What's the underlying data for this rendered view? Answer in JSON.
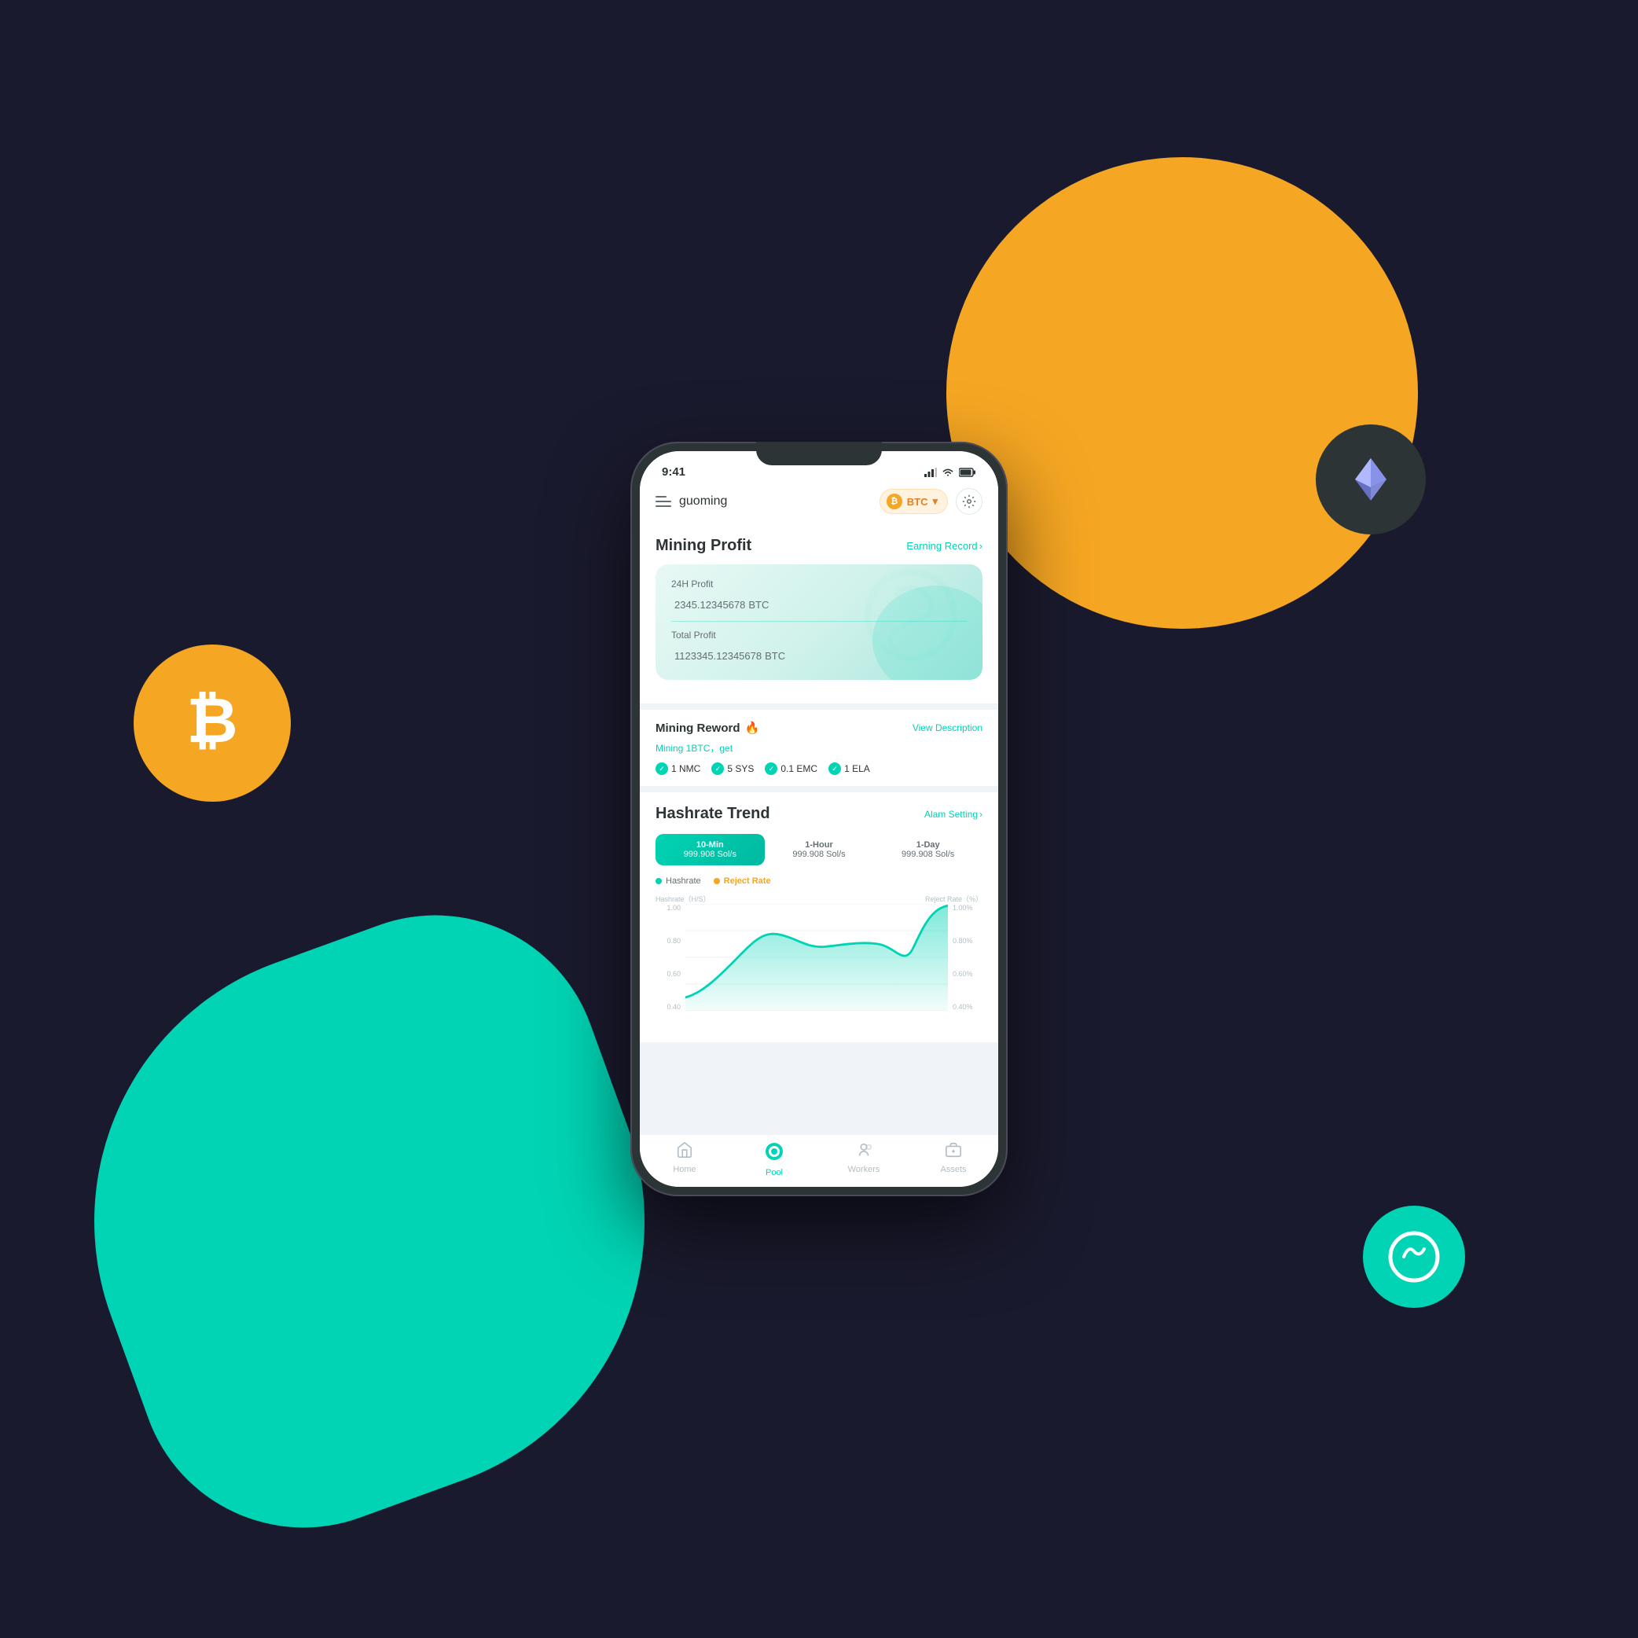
{
  "background": {
    "color": "#1a1a2e"
  },
  "status_bar": {
    "time": "9:41",
    "signal": "▂▄▆",
    "wifi": "wifi",
    "battery": "battery"
  },
  "header": {
    "menu_label": "menu",
    "username": "guoming",
    "btc_label": "BTC",
    "chevron": "›",
    "setting_icon": "⬡"
  },
  "mining_profit": {
    "title": "Mining Profit",
    "earning_record_label": "Earning Record",
    "earning_record_chevron": "›",
    "profit_24h_label": "24H Profit",
    "profit_24h_value": "2345.12345678",
    "profit_24h_unit": "BTC",
    "profit_total_label": "Total Profit",
    "profit_total_value": "1123345.12345678",
    "profit_total_unit": "BTC"
  },
  "mining_reward": {
    "title": "Mining Reword",
    "fire_emoji": "🔥",
    "view_description_label": "View Description",
    "subtitle": "Mining 1BTC，get",
    "items": [
      {
        "value": "1 NMC"
      },
      {
        "value": "5 SYS"
      },
      {
        "value": "0.1 EMC"
      },
      {
        "value": "1 ELA"
      }
    ]
  },
  "hashrate_trend": {
    "title": "Hashrate Trend",
    "alarm_label": "Alam Setting",
    "alarm_chevron": "›",
    "tabs": [
      {
        "label": "10-Min",
        "value": "999.908 Sol/s",
        "active": true
      },
      {
        "label": "1-Hour",
        "value": "999.908 Sol/s",
        "active": false
      },
      {
        "label": "1-Day",
        "value": "999.908 Sol/s",
        "active": false
      }
    ],
    "legend": {
      "hashrate_label": "Hashrate",
      "reject_rate_label": "Reject Rate"
    },
    "y_axis_left": {
      "title": "Hashrate（H/S）",
      "values": [
        "1.00",
        "0.80",
        "0.60",
        "0.40"
      ]
    },
    "y_axis_right": {
      "title": "Reject Rate（%）",
      "values": [
        "1.00%",
        "0.80%",
        "0.60%",
        "0.40%"
      ]
    }
  },
  "bottom_nav": {
    "items": [
      {
        "label": "Home",
        "icon": "🏠",
        "active": false
      },
      {
        "label": "Pool",
        "icon": "🔵",
        "active": true
      },
      {
        "label": "Workers",
        "icon": "⚙️",
        "active": false
      },
      {
        "label": "Assets",
        "icon": "💼",
        "active": false
      }
    ]
  }
}
